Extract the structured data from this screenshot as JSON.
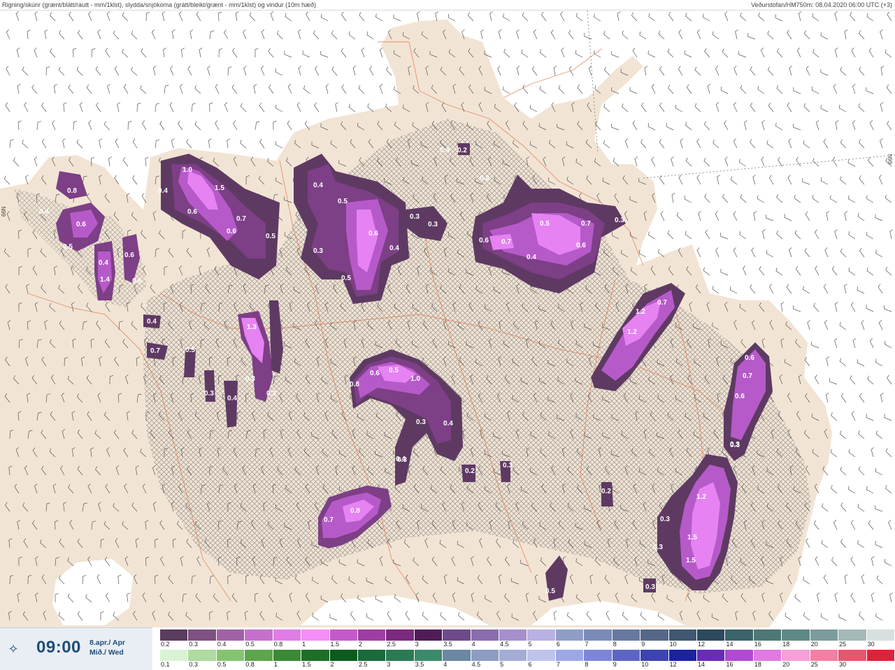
{
  "header": {
    "title": "Rigning/skúrir (grænt/blátt/rautt - mm/1klst), slydda/snjókoma (grátt/bleikt/grænt - mm/1klst) og vindur (10m hæð)",
    "source": "Veðurstofan/HM750m: 08.04.2020 06:00 UTC (+3)"
  },
  "map": {
    "colors": {
      "sea": "#ffffff",
      "land": "#f2e4d4",
      "glacier": "#ffffff",
      "roads": "#e07a52",
      "precip_light": "#5e3a63",
      "precip_mid": "#7d3f86",
      "precip_high": "#b65ac9",
      "precip_peak": "#e682f2"
    },
    "grid_labels": [
      "66N",
      "66N"
    ],
    "value_labels": [
      "1.0",
      "0.4",
      "0.4",
      "0.8",
      "0.6",
      "1.5",
      "0.7",
      "0.6",
      "0.5",
      "0.6",
      "0.4",
      "1.4",
      "0.5",
      "0.6",
      "0.6",
      "0.4",
      "0.7",
      "0.5",
      "0.4",
      "0.5",
      "0.6",
      "0.4",
      "0.3",
      "0.5",
      "0.3",
      "0.3",
      "0.4",
      "0.2",
      "0.2",
      "0.6",
      "0.7",
      "0.5",
      "0.7",
      "0.6",
      "0.4",
      "0.3",
      "1.2",
      "0.7",
      "1.2",
      "1.3",
      "0.3",
      "0.4",
      "0.3",
      "0.3",
      "0.3",
      "0.8",
      "0.6",
      "0.5",
      "1.0",
      "0.3",
      "0.4",
      "0.4",
      "0.2",
      "0.3",
      "0.7",
      "0.8",
      "0.2",
      "0.6",
      "0.7",
      "0.6",
      "0.3",
      "1.2",
      "0.3",
      "1.5",
      "0.3",
      "1.5",
      "0.3",
      "0.5",
      "0.3"
    ]
  },
  "footer": {
    "time": "09:00",
    "date_line1": "8.apr./ Apr",
    "date_line2": "Mið./ Wed",
    "scale_snow": {
      "labels": [
        "0.2",
        "0.3",
        "0.4",
        "0.5",
        "0.8",
        "1",
        "1.5",
        "2",
        "2.5",
        "3",
        "3.5",
        "4",
        "4.5",
        "5",
        "6",
        "7",
        "8",
        "9",
        "10",
        "12",
        "14",
        "16",
        "18",
        "20",
        "25",
        "30"
      ],
      "colors": [
        "#5b3b5e",
        "#7e5180",
        "#a161a6",
        "#c670cc",
        "#e07ce6",
        "#f48ef6",
        "#c45ac9",
        "#9d3ea3",
        "#7a2a7f",
        "#4f1d56",
        "#6f4a8a",
        "#8b6cae",
        "#a68fcc",
        "#b9b1e4",
        "#8f9dc6",
        "#7a8bb8",
        "#67799f",
        "#546789",
        "#3f5771",
        "#2c4a5c",
        "#3c6369",
        "#4e7775",
        "#5f8987",
        "#7a9c9b",
        "#a3b9b7",
        "#d6e0df"
      ]
    },
    "scale_rain": {
      "labels": [
        "0.1",
        "0.3",
        "0.5",
        "0.8",
        "1",
        "1.5",
        "2",
        "2.5",
        "3",
        "3.5",
        "4",
        "4.5",
        "5",
        "6",
        "7",
        "8",
        "9",
        "10",
        "12",
        "14",
        "16",
        "18",
        "20",
        "25",
        "30"
      ],
      "colors": [
        "#d9f2d4",
        "#aedb9f",
        "#85c46f",
        "#5da64b",
        "#3a8a35",
        "#1e6e28",
        "#0c5a1c",
        "#1a6a3c",
        "#2b7a55",
        "#3b8a6c",
        "#6b87a3",
        "#8d9cc2",
        "#a3acd6",
        "#bfc4ec",
        "#9ea7e6",
        "#7d86d6",
        "#5d65c4",
        "#3d44b2",
        "#1c22a0",
        "#6a2bb8",
        "#b14ad2",
        "#e07ae0",
        "#f5a0d9",
        "#f47fa4",
        "#e8556d",
        "#d9253a"
      ]
    }
  }
}
